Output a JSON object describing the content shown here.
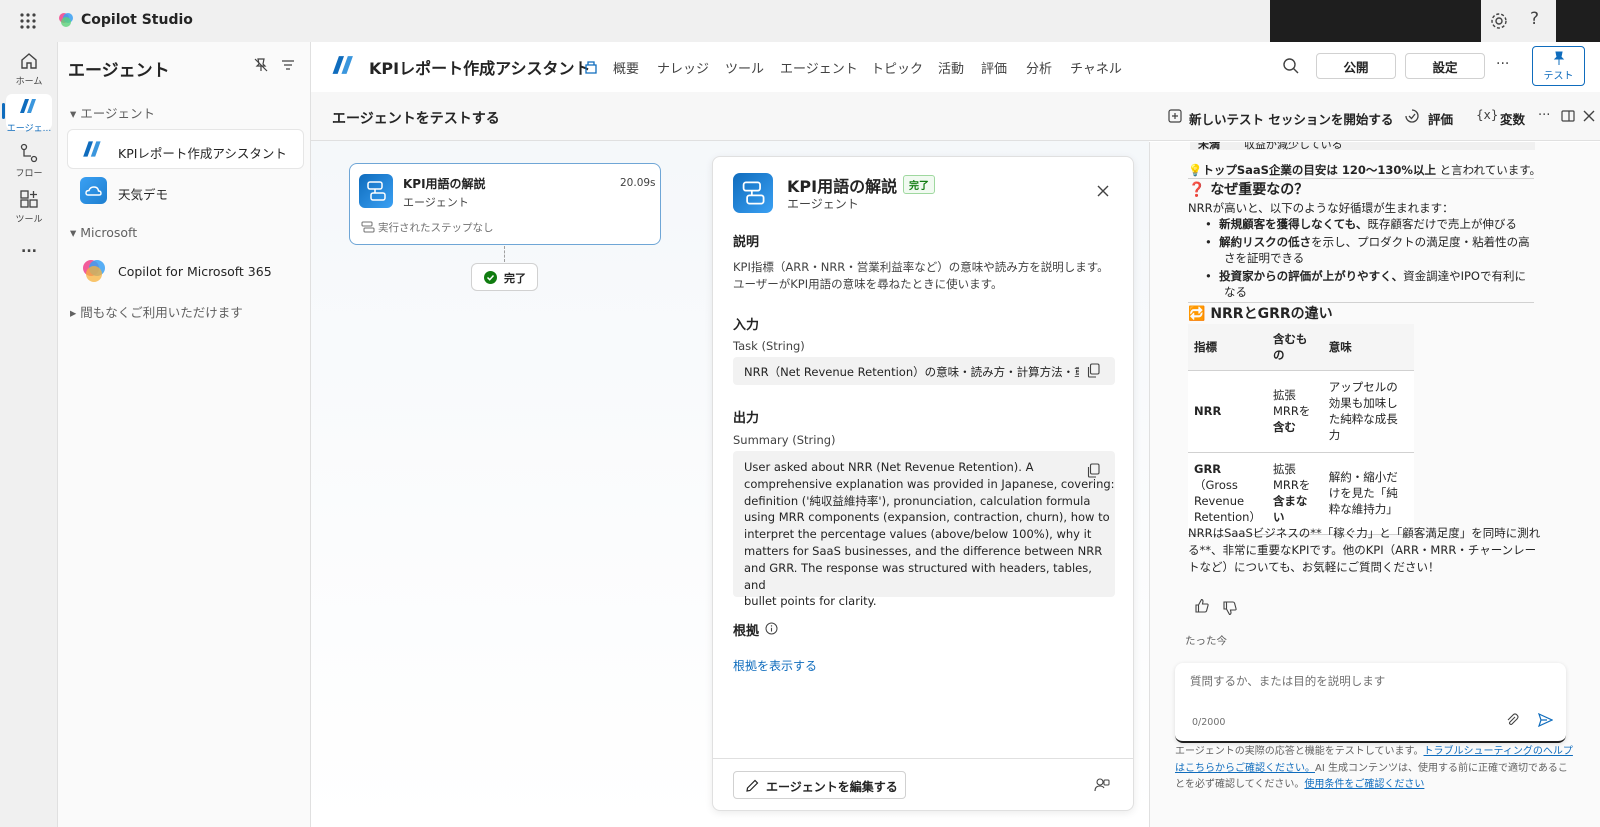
{
  "app": {
    "title": "Copilot Studio"
  },
  "rail": {
    "home": "ホーム",
    "agents": "エージェ...",
    "flows": "フロー",
    "tools": "ツール",
    "more": "..."
  },
  "agents_pane": {
    "title": "エージェント",
    "group_agents": "エージェント",
    "items": [
      "KPIレポート作成アシスタント",
      "天気デモ"
    ],
    "group_microsoft": "Microsoft",
    "microsoft_item": "Copilot for Microsoft 365",
    "coming_soon": "間もなくご利用いただけます"
  },
  "header": {
    "agent_name": "KPIレポート作成アシスタント",
    "tabs": [
      "概要",
      "ナレッジ",
      "ツール",
      "エージェント",
      "トピック",
      "活動",
      "評価",
      "分析",
      "チャネル"
    ],
    "publish": "公開",
    "settings": "設定",
    "more": "···",
    "test": "テスト"
  },
  "test_header": {
    "title": "エージェントをテストする",
    "new_session": "新しいテスト セッションを開始する",
    "evaluate": "評価",
    "variables": "変数",
    "more": "···"
  },
  "flow_card": {
    "title": "KPI用語の解説",
    "time": "20.09s",
    "subtitle": "エージェント",
    "steps": "実行されたステップなし",
    "done": "完了"
  },
  "detail": {
    "title": "KPI用語の解説",
    "badge": "完了",
    "subtitle": "エージェント",
    "desc_title": "説明",
    "desc_line1": "KPI指標（ARR・NRR・営業利益率など）の意味や読み方を説明します。",
    "desc_line2": "ユーザーがKPI用語の意味を尋ねたときに使います。",
    "input_title": "入力",
    "input_label": "Task (String)",
    "input_value": "NRR（Net Revenue Retention）の意味・読み方・計算方法・重",
    "output_title": "出力",
    "output_label": "Summary (String)",
    "output_lines": [
      "User asked about NRR (Net Revenue Retention). A",
      "comprehensive explanation was provided in Japanese, covering:",
      "definition ('純収益維持率'), pronunciation, calculation formula",
      "using MRR components (expansion, contraction, churn), how to",
      "interpret the percentage values (above/below 100%), why it",
      "matters for SaaS businesses, and the difference between NRR",
      "and GRR. The response was structured with headers, tables, and",
      "bullet points for clarity."
    ],
    "evidence_title": "根拠",
    "evidence_link": "根拠を表示する",
    "edit_button": "エージェントを編集する"
  },
  "chat": {
    "row_top_a": "未満",
    "row_top_b": "収益が減少している",
    "tip_bold": "トップSaaS企業の目安は 120〜130%以上",
    "tip_rest": " と言われています。",
    "why_title": "なぜ重要なの？",
    "why_intro": "NRRが高いと、以下のような好循環が生まれます：",
    "bullets": [
      {
        "bold": "新規顧客を獲得しなくても、",
        "rest": "既存顧客だけで売上が伸びる"
      },
      {
        "bold": "解約リスクの低さ",
        "rest": "を示し、プロダクトの満足度・粘着性の高",
        "cont": "さを証明できる"
      },
      {
        "bold": "投資家からの評価が上がりやすく、",
        "rest": "資金調達やIPOで有利に",
        "cont": "なる"
      }
    ],
    "diff_title": "NRRとGRRの違い",
    "table_head": [
      "指標",
      "含むもの",
      "意味"
    ],
    "table_rows": [
      {
        "name": "NRR",
        "name_rest": "",
        "incl": "拡張MRRを",
        "incl_bold": "含む",
        "meaning": "アップセルの効果も加味した純粋な成長力"
      },
      {
        "name": "GRR",
        "name_rest": "（Gross Revenue Retention）",
        "incl": "拡張MRRを",
        "incl_bold": "含まない",
        "meaning": "解約・縮小だけを見た「純粋な維持力」"
      }
    ],
    "closing_lines": [
      "NRRはSaaSビジネスの**「稼ぐ力」と「顧客満足度」を同時に測れ",
      "る**、非常に重要なKPIです。他のKPI（ARR・MRR・チャーンレー",
      "トなど）についても、お気軽にご質問ください！"
    ],
    "timestamp": "たった今",
    "input_placeholder": "質問するか、または目的を説明します",
    "counter": "0/2000",
    "disclaimer_a": "エージェントの実際の応答と機能をテストしています。",
    "disclaimer_link1": "トラブルシューティングのヘルプはこちらからご確認ください。",
    "disclaimer_b": "AI 生成コンテンツは、使用する前に正確で適切であることを必ず確認してください。",
    "disclaimer_link2": "使用条件をご確認ください"
  },
  "colors": {
    "accent": "#0f6cbd",
    "success": "#107c10",
    "badge_bg": "#f1faf1"
  }
}
